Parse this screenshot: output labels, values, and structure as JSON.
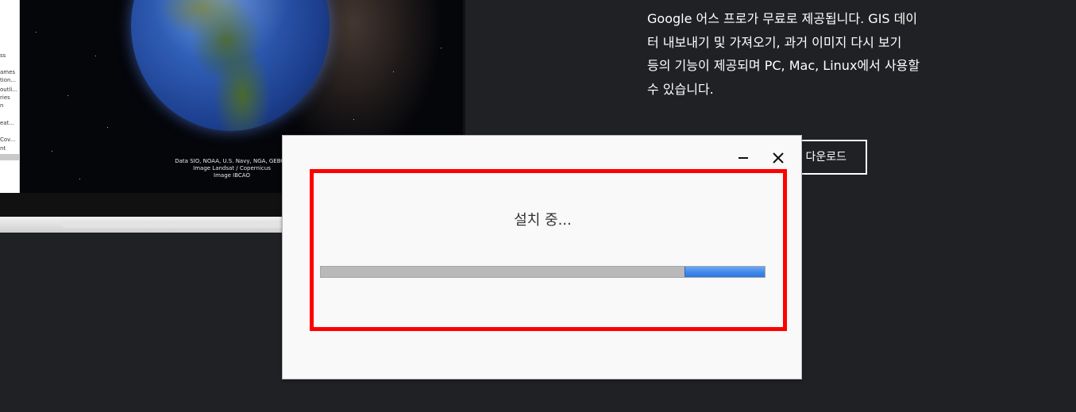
{
  "laptop": {
    "side_panel_lines": [
      "ss",
      "ames",
      "tion...",
      "outli...",
      "ries",
      "n",
      "eat...",
      "Cov...",
      "nt"
    ],
    "attribution": [
      "Data SIO, NOAA, U.S. Navy, NGA, GEBCO",
      "Image Landsat / Copernicus",
      "Image IBCAO"
    ]
  },
  "promo": {
    "lines": [
      "Google 어스 프로가 무료로 제공됩니다. GIS 데이",
      "터 내보내기 및 가져오기, 과거 이미지 다시 보기",
      "등의 기능이 제공되며 PC, Mac, Linux에서 사용할",
      "수 있습니다."
    ],
    "download_button_label": "다운로드"
  },
  "installer": {
    "status": "설치 중...",
    "progress": {
      "indeterminate": true,
      "chunk_start_percent": 82,
      "chunk_width_percent": 18
    },
    "minimize_icon": "minimize-icon",
    "close_icon": "close-icon"
  },
  "colors": {
    "page_background": "#202124",
    "highlight_border": "#ff0000",
    "progress_track": "#b9b9b9",
    "progress_fill": "#3d86ea"
  }
}
